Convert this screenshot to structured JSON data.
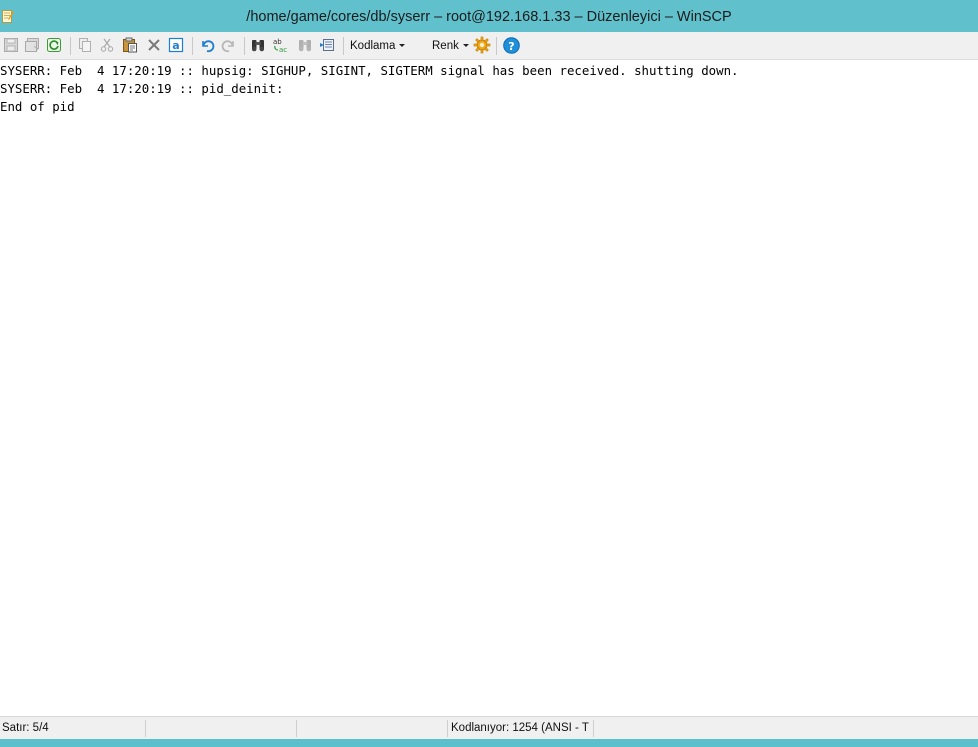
{
  "window": {
    "title": "/home/game/cores/db/syserr – root@192.168.1.33 – Düzenleyici – WinSCP"
  },
  "toolbar": {
    "encoding_label": "Kodlama",
    "color_label": "Renk",
    "buttons": [
      "save-icon",
      "save-all-icon",
      "reload-icon",
      "copy-icon",
      "cut-icon",
      "paste-icon",
      "delete-icon",
      "select-all-icon",
      "undo-icon",
      "redo-icon",
      "find-icon",
      "replace-icon",
      "find-next-icon",
      "goto-line-icon",
      "preferences-icon",
      "help-icon"
    ]
  },
  "editor": {
    "lines": [
      "SYSERR: Feb  4 17:20:19 :: hupsig: SIGHUP, SIGINT, SIGTERM signal has been received. shutting down.",
      "SYSERR: Feb  4 17:20:19 :: pid_deinit:",
      "End of pid"
    ]
  },
  "statusbar": {
    "line_info": "Satır: 5/4",
    "encoding_info": "Kodlanıyor: 1254  (ANSI - T"
  },
  "colors": {
    "titlebar": "#60c1cd",
    "toolbar": "#f0f0f0",
    "accent_green": "#2e9a3a",
    "accent_blue": "#1e7fd0"
  }
}
